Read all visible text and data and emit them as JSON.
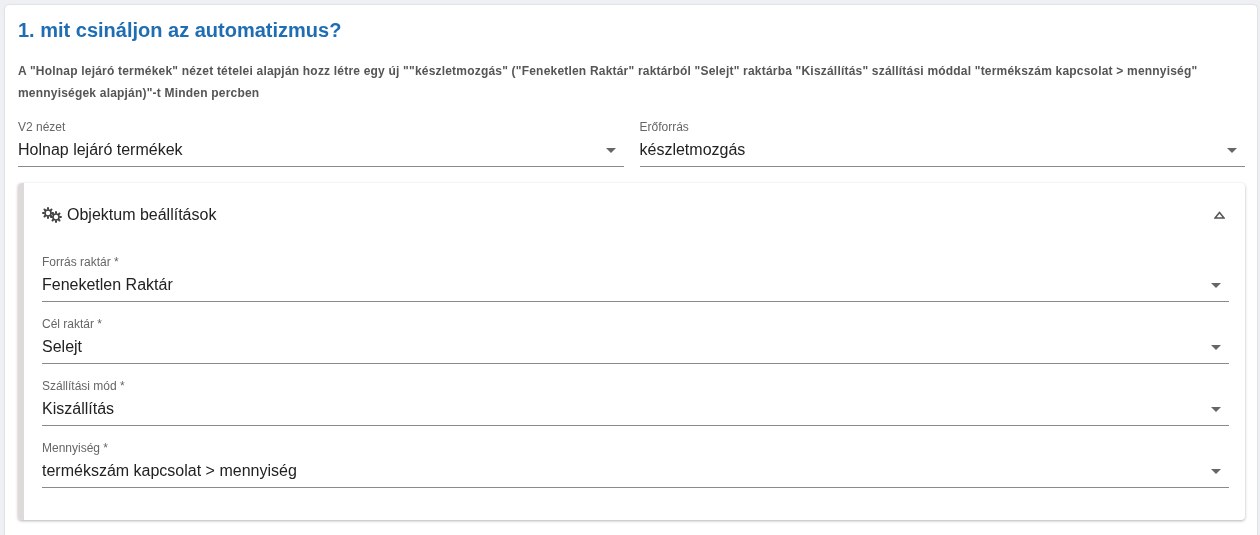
{
  "title": "1. mit csináljon az automatizmus?",
  "description": "A \"Holnap lejáró termékek\" nézet tételei alapján hozz létre egy új \"\"készletmozgás\" (\"Feneketlen Raktár\" raktárból \"Selejt\" raktárba \"Kiszállítás\" szállítási móddal \"termékszám kapcsolat > mennyiség\" mennyiségek alapján)\"-t Minden percben",
  "top_fields": [
    {
      "label": "V2 nézet",
      "value": "Holnap lejáró termékek"
    },
    {
      "label": "Erőforrás",
      "value": "készletmozgás"
    }
  ],
  "panel": {
    "title": "Objektum beállítások",
    "expanded": true,
    "fields": [
      {
        "label": "Forrás raktár *",
        "value": "Feneketlen Raktár"
      },
      {
        "label": "Cél raktár *",
        "value": "Selejt"
      },
      {
        "label": "Szállítási mód *",
        "value": "Kiszállítás"
      },
      {
        "label": "Mennyiség *",
        "value": "termékszám kapcsolat > mennyiség"
      }
    ]
  }
}
